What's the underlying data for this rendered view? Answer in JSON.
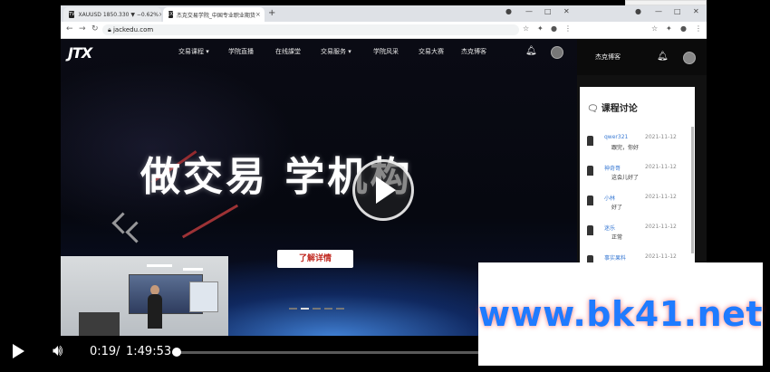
{
  "browser": {
    "tabs": [
      {
        "favicon": "TV",
        "label": "XAUUSD 1850.330 ▼ −0.62%"
      },
      {
        "favicon": "JX",
        "label": "杰克交易学院_中国专业职业期货"
      }
    ],
    "url": "jackedu.com"
  },
  "site": {
    "logo": "JTX",
    "nav": [
      "交易课程 ▾",
      "学院直播",
      "在线課堂",
      "交易服务 ▾",
      "学院风采",
      "交易大赛",
      "杰克博客"
    ],
    "hero_title": "做交易 学机构",
    "cta_label": "了解详情",
    "carousel_dots": 5,
    "carousel_active": 1
  },
  "side": {
    "nav_item": "杰克博客",
    "discussion_title": "课程讨论",
    "comments": [
      {
        "user": "qwer321",
        "date": "2021-11-12",
        "text": "跟完，你好"
      },
      {
        "user": "神奇哥",
        "date": "2021-11-12",
        "text": "这会儿好了"
      },
      {
        "user": "小林",
        "date": "2021-11-12",
        "text": "好了"
      },
      {
        "user": "迷乐",
        "date": "2021-11-12",
        "text": "正常"
      },
      {
        "user": "事实果料",
        "date": "2021-11-12",
        "text": ""
      }
    ]
  },
  "watermark": "www.bk41.net",
  "player": {
    "time_current": "0:19",
    "separator": "/",
    "time_total": "1:49:53",
    "progress_fraction": 0.003
  },
  "colors": {
    "accent_link": "#3b7bd4",
    "cta_text": "#c0271f",
    "watermark": "#1f7bff"
  },
  "icons": [
    "back-arrow-icon",
    "forward-arrow-icon",
    "reload-icon",
    "lock-icon",
    "star-icon",
    "extensions-icon",
    "bell-icon",
    "play-icon",
    "volume-icon"
  ]
}
